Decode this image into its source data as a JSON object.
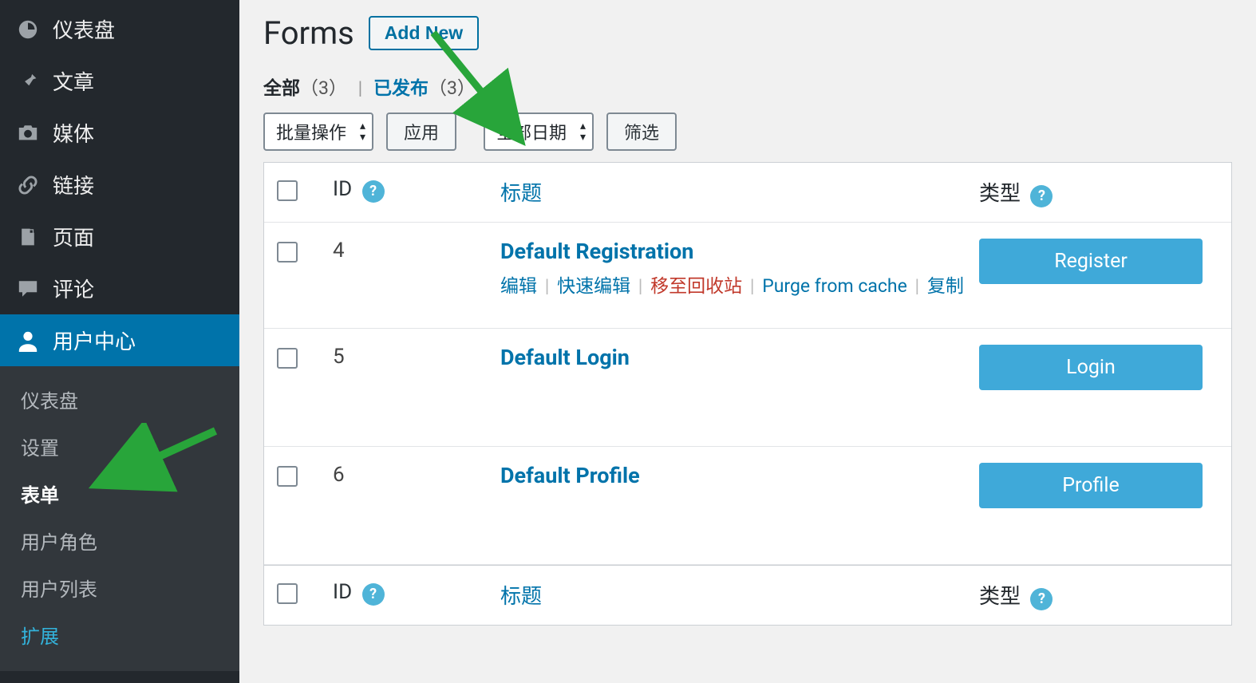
{
  "sidebar": {
    "items": [
      {
        "label": "仪表盘"
      },
      {
        "label": "文章"
      },
      {
        "label": "媒体"
      },
      {
        "label": "链接"
      },
      {
        "label": "页面"
      },
      {
        "label": "评论"
      },
      {
        "label": "用户中心"
      }
    ],
    "submenu": [
      {
        "label": "仪表盘"
      },
      {
        "label": "设置"
      },
      {
        "label": "表单"
      },
      {
        "label": "用户角色"
      },
      {
        "label": "用户列表"
      },
      {
        "label": "扩展"
      }
    ]
  },
  "header": {
    "title": "Forms",
    "add_new": "Add New"
  },
  "filters": {
    "all_label": "全部",
    "all_count": "（3）",
    "published_label": "已发布",
    "published_count": "（3）"
  },
  "tablenav": {
    "bulk": "批量操作",
    "apply": "应用",
    "all_dates": "全部日期",
    "filter": "筛选"
  },
  "table": {
    "columns": {
      "id": "ID",
      "title": "标题",
      "type": "类型"
    },
    "rows": [
      {
        "id": "4",
        "title": "Default Registration",
        "type": "Register",
        "actions": {
          "edit": "编辑",
          "quick_edit": "快速编辑",
          "trash": "移至回收站",
          "purge": "Purge from cache",
          "copy": "复制"
        },
        "show_actions": true
      },
      {
        "id": "5",
        "title": "Default Login",
        "type": "Login",
        "show_actions": false
      },
      {
        "id": "6",
        "title": "Default Profile",
        "type": "Profile",
        "show_actions": false
      }
    ]
  }
}
